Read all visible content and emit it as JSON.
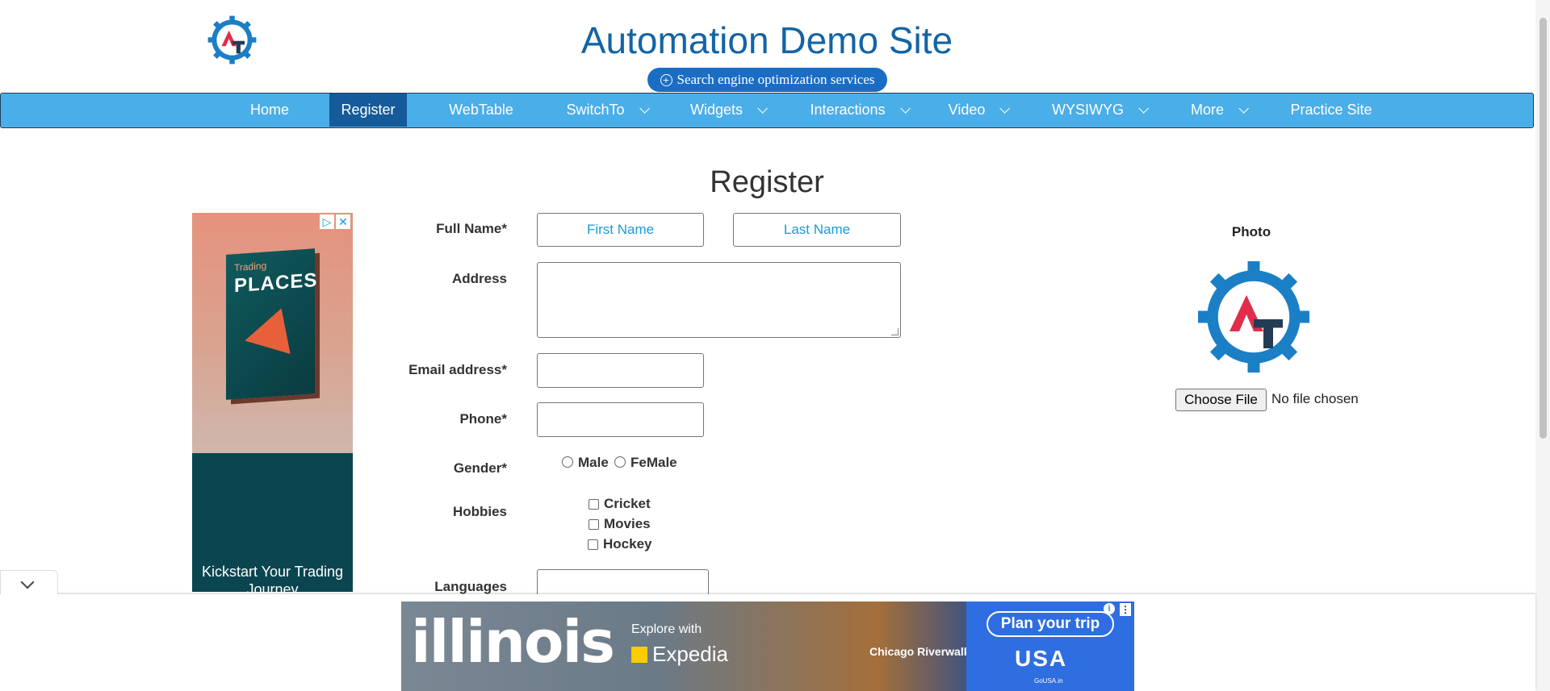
{
  "header": {
    "title": "Automation Demo Site",
    "seo_link": "Search engine optimization services"
  },
  "nav": {
    "items": [
      {
        "label": "Home"
      },
      {
        "label": "Register"
      },
      {
        "label": "WebTable"
      },
      {
        "label": "SwitchTo"
      },
      {
        "label": "Widgets"
      },
      {
        "label": "Interactions"
      },
      {
        "label": "Video"
      },
      {
        "label": "WYSIWYG"
      },
      {
        "label": "More"
      },
      {
        "label": "Practice Site"
      }
    ],
    "active": "Register",
    "colors": {
      "bar": "#4aaee8",
      "active": "#155a9a"
    }
  },
  "page": {
    "heading": "Register"
  },
  "form": {
    "full_name_label": "Full Name*",
    "first_name_placeholder": "First Name",
    "last_name_placeholder": "Last Name",
    "address_label": "Address",
    "email_label": "Email address*",
    "phone_label": "Phone*",
    "gender_label": "Gender*",
    "gender_options": [
      "Male",
      "FeMale"
    ],
    "hobbies_label": "Hobbies",
    "hobbies": [
      "Cricket",
      "Movies",
      "Hockey"
    ],
    "languages_label": "Languages"
  },
  "photo": {
    "label": "Photo",
    "button": "Choose File",
    "status": "No file chosen"
  },
  "ads": {
    "left": {
      "book_small": "Trading",
      "book_title": "PLACES",
      "caption": "Kickstart Your Trading Journey"
    },
    "bottom": {
      "brand": "illinois",
      "explore": "Explore with",
      "expedia": "Expedia",
      "place": "Chicago Riverwalk",
      "cta": "Plan your trip",
      "usa": "USA",
      "gousa": "GoUSA.in"
    }
  },
  "icons": {
    "logo": "automation-tester-gear-logo",
    "seo": "plus-circle-icon",
    "nav_dropdown": "chevron-down-icon"
  }
}
